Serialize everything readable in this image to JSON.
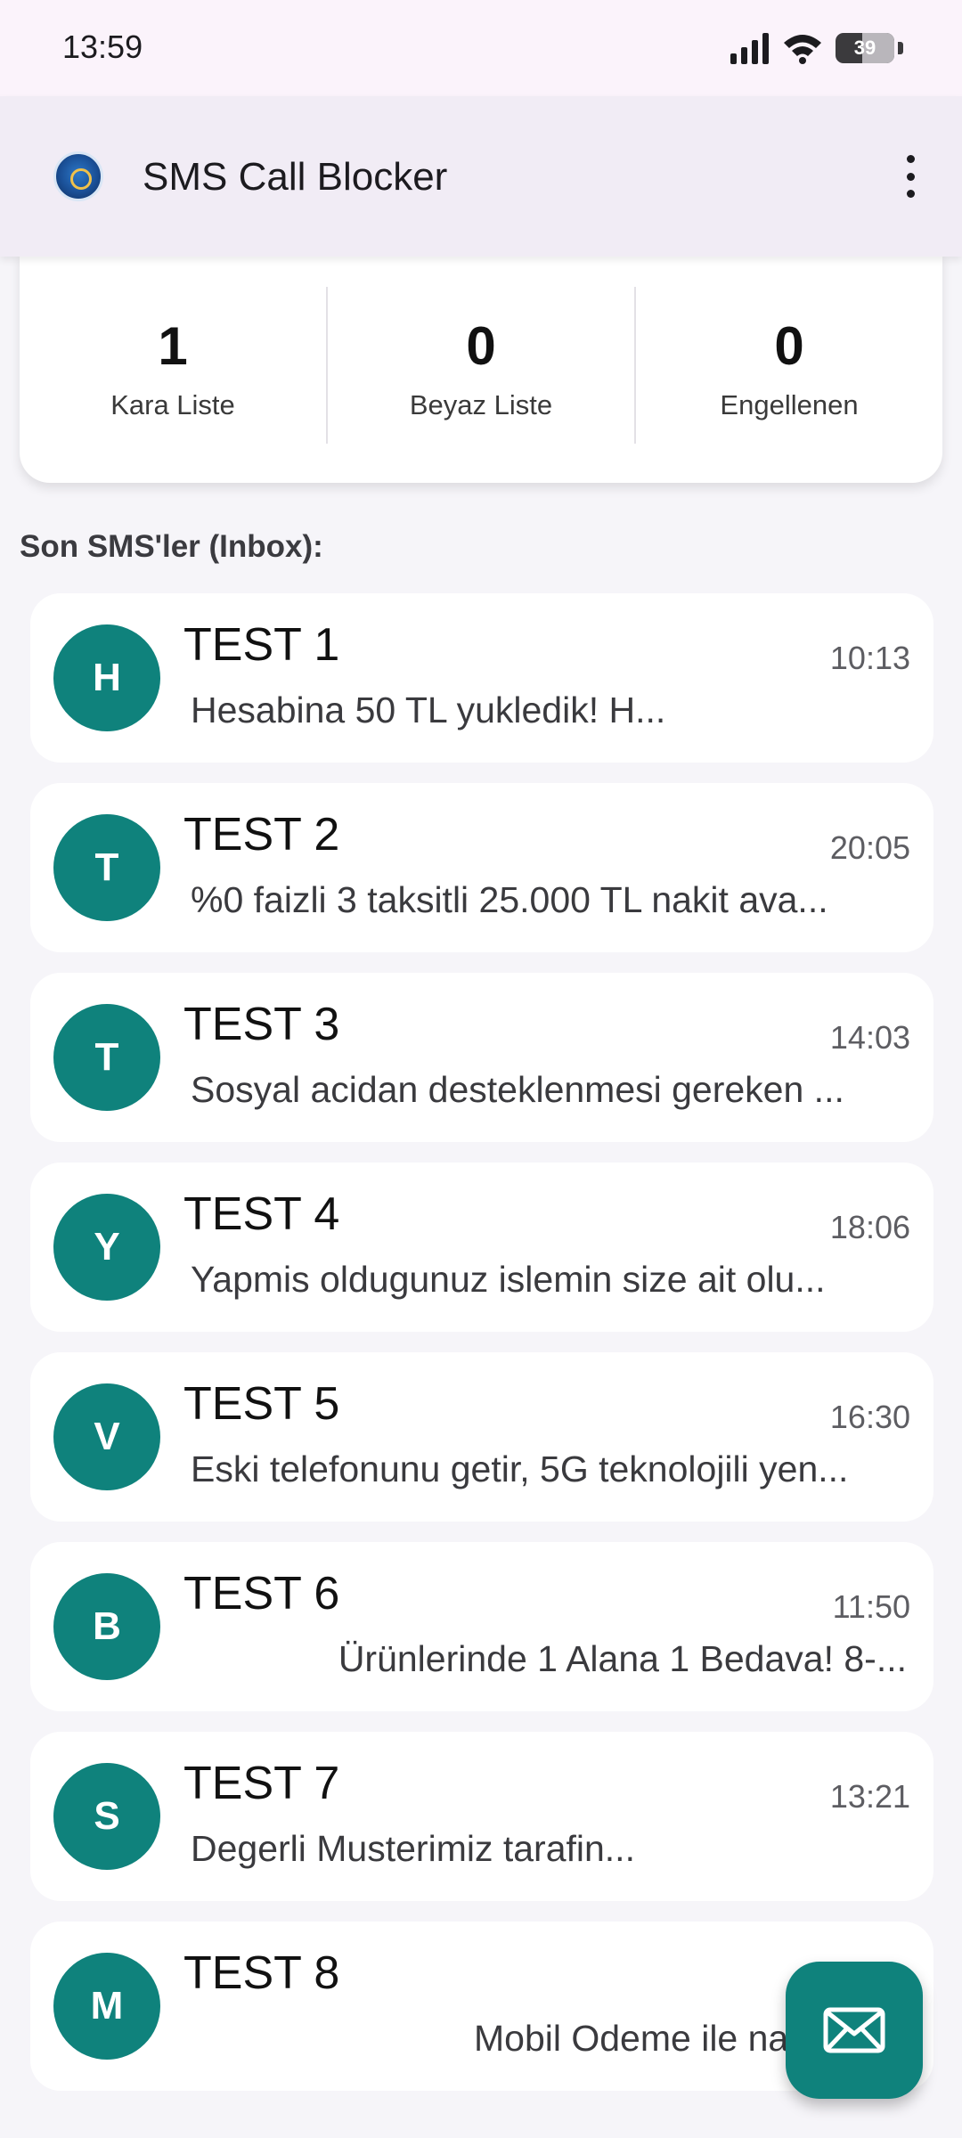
{
  "status_bar": {
    "time": "13:59",
    "battery": "39"
  },
  "app_bar": {
    "title": "SMS Call Blocker"
  },
  "stats": [
    {
      "value": "1",
      "label": "Kara Liste"
    },
    {
      "value": "0",
      "label": "Beyaz Liste"
    },
    {
      "value": "0",
      "label": "Engellenen"
    }
  ],
  "section_title": "Son SMS'ler (Inbox):",
  "messages": [
    {
      "initial": "H",
      "sender": "TEST 1",
      "time": "10:13",
      "preview": "Hesabina 50 TL                     yukledik! H..."
    },
    {
      "initial": "T",
      "sender": "TEST 2",
      "time": "20:05",
      "preview": "%0 faizli 3 taksitli 25.000 TL nakit ava..."
    },
    {
      "initial": "T",
      "sender": "TEST 3",
      "time": "14:03",
      "preview": "Sosyal acidan desteklenmesi gereken ..."
    },
    {
      "initial": "Y",
      "sender": "TEST 4",
      "time": "18:06",
      "preview": "Yapmis oldugunuz islemin size ait olu..."
    },
    {
      "initial": "V",
      "sender": "TEST 5",
      "time": "16:30",
      "preview": "Eski telefonunu getir, 5G teknolojili yen..."
    },
    {
      "initial": "B",
      "sender": "TEST 6",
      "time": "11:50",
      "preview": "Ürünlerinde 1 Alana 1 Bedava! 8-..."
    },
    {
      "initial": "S",
      "sender": "TEST 7",
      "time": "13:21",
      "preview": "Degerli Musterimiz                        tarafin..."
    },
    {
      "initial": "M",
      "sender": "TEST 8",
      "time": "",
      "preview": "Mobil Odeme ile na"
    }
  ],
  "colors": {
    "accent": "#0f827c",
    "app_bar": "#f1ecf5",
    "background": "#f6f5f9"
  }
}
